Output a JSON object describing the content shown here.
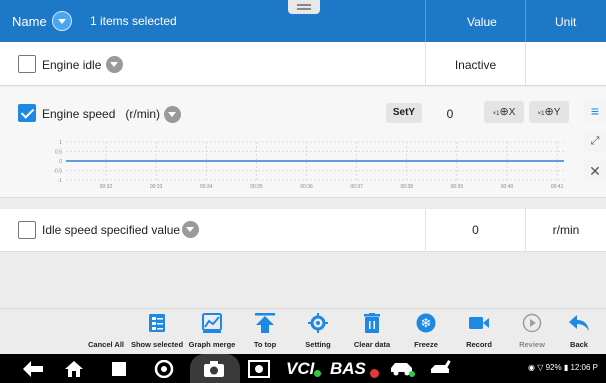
{
  "header": {
    "name_label": "Name",
    "selection_text": "1 items selected",
    "value_col": "Value",
    "unit_col": "Unit"
  },
  "rows": [
    {
      "label": "Engine idle",
      "checked": false,
      "value": "Inactive",
      "unit": ""
    },
    {
      "label": "Engine speed   (r/min)",
      "checked": true,
      "value": "0",
      "unit": ""
    },
    {
      "label": "Idle speed specified value",
      "checked": false,
      "value": "0",
      "unit": "r/min"
    }
  ],
  "graph": {
    "sety_label": "SetY",
    "zoom_x_label": "X",
    "zoom_y_label": "Y",
    "zoom_multiplier": "×1",
    "y_ticks": [
      "1",
      "0.5",
      "0",
      "-0.5",
      "-1"
    ],
    "x_ticks": [
      "00:32",
      "00:33",
      "00:34",
      "00:35",
      "00:36",
      "00:37",
      "00:38",
      "00:39",
      "00:40",
      "00:41"
    ],
    "series_value": 0,
    "y_range": [
      -1,
      1
    ],
    "line_color": "#2e7fd6"
  },
  "toolbar": {
    "items": [
      {
        "label": "Cancel All",
        "icon": "none"
      },
      {
        "label": "Show selected",
        "icon": "list-check-icon"
      },
      {
        "label": "Graph merge",
        "icon": "graph-merge-icon"
      },
      {
        "label": "To top",
        "icon": "to-top-icon"
      },
      {
        "label": "Setting",
        "icon": "setting-icon"
      },
      {
        "label": "Clear data",
        "icon": "trash-icon"
      },
      {
        "label": "Freeze",
        "icon": "snowflake-icon"
      },
      {
        "label": "Record",
        "icon": "video-icon"
      },
      {
        "label": "Review",
        "icon": "play-circle-icon"
      },
      {
        "label": "Back",
        "icon": "back-arrow-icon"
      }
    ]
  },
  "system_bar": {
    "vci_text": "VCI",
    "bas_text": "BAS",
    "status_text": "◉ ▽ 92% ▮ 12:06 P"
  },
  "colors": {
    "accent": "#1e78c8",
    "toolbar_icon": "#1e88e5"
  }
}
